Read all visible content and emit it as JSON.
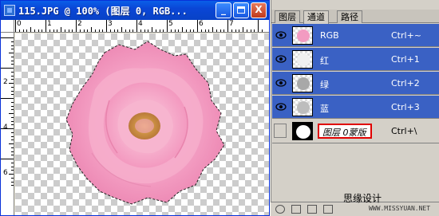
{
  "window": {
    "title": "115.JPG @ 100% (图层 0, RGB...",
    "minimize_label": "_",
    "close_label": "X"
  },
  "rulers": {
    "top_numbers": [
      "0",
      "1",
      "2",
      "3",
      "4",
      "5",
      "6",
      "7"
    ],
    "left_numbers": [
      "2",
      "4",
      "6"
    ]
  },
  "palette": {
    "tabs": [
      "图层",
      "通道",
      "路径"
    ],
    "active_tab": "通道",
    "channels": [
      {
        "name": "RGB",
        "shortcut": "Ctrl+~",
        "selected": true,
        "visible": true,
        "thumb_color": "#f29bc1"
      },
      {
        "name": "红",
        "shortcut": "Ctrl+1",
        "selected": true,
        "visible": true,
        "thumb_color": "#f0f0f0"
      },
      {
        "name": "绿",
        "shortcut": "Ctrl+2",
        "selected": true,
        "visible": true,
        "thumb_color": "#a8a8a8"
      },
      {
        "name": "蓝",
        "shortcut": "Ctrl+3",
        "selected": true,
        "visible": true,
        "thumb_color": "#bdbdbd"
      }
    ],
    "mask_channel": {
      "name": "图层 0蒙版",
      "shortcut": "Ctrl+\\",
      "selected": false,
      "visible": false
    }
  },
  "watermark": {
    "text_cn": "思缘设计",
    "url": "WWW.MISSYUAN.NET"
  },
  "colors": {
    "titlebar": "#0a46d6",
    "selection": "#3a61c4",
    "highlight_box": "#e00000",
    "rose_pink": "#f4a6c8",
    "rose_center": "#d8a040"
  }
}
